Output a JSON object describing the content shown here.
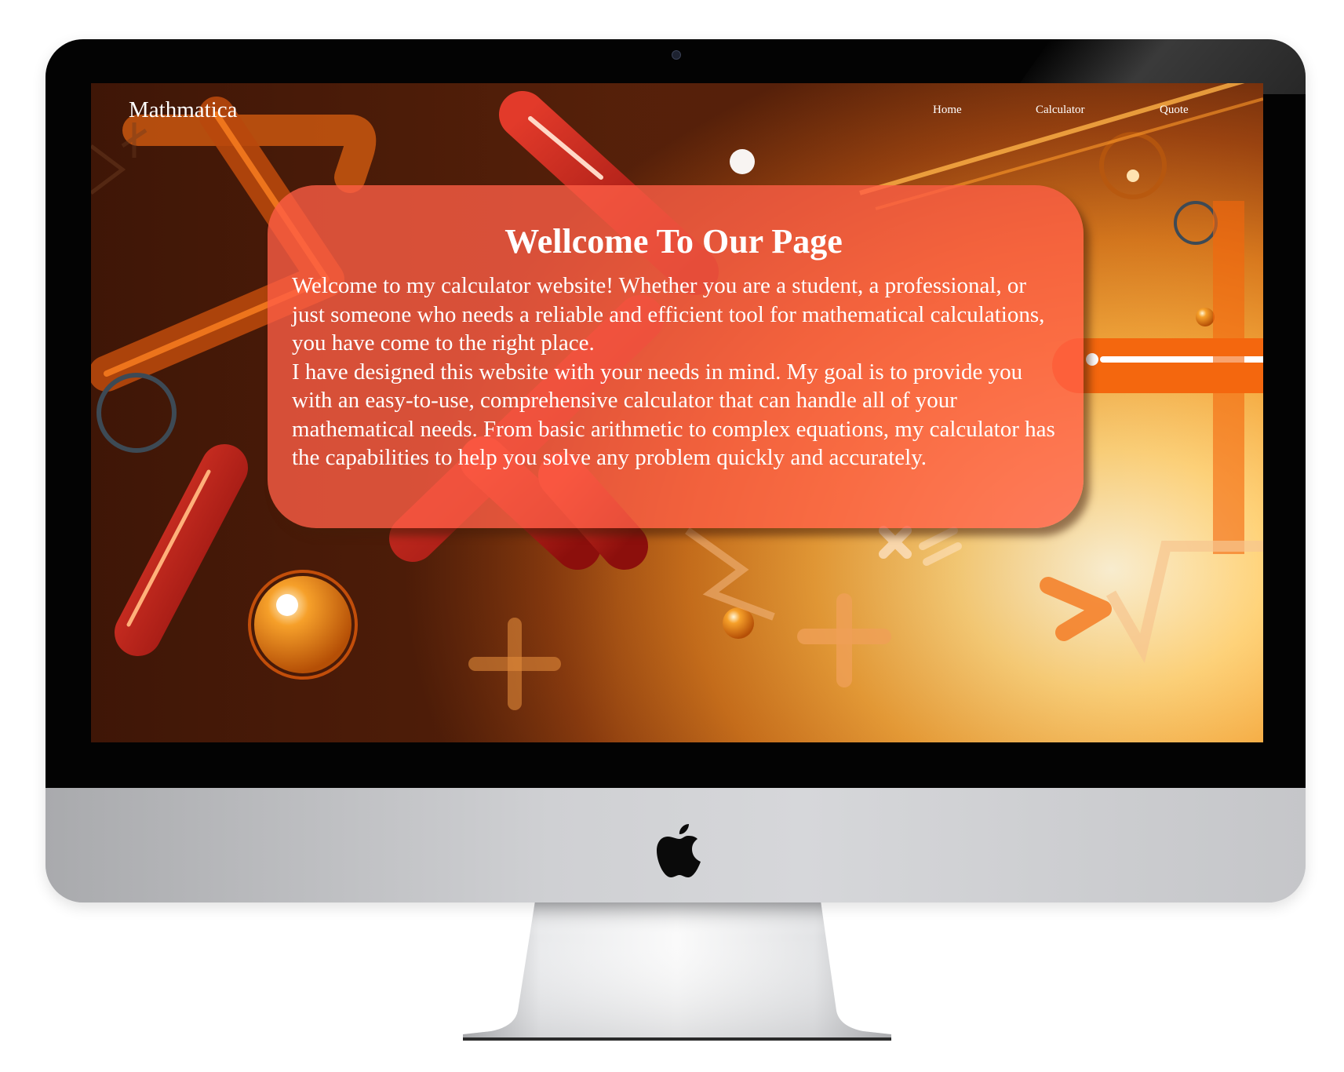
{
  "site": {
    "brand": "Mathmatica"
  },
  "nav": {
    "items": [
      {
        "label": "Home"
      },
      {
        "label": "Calculator"
      },
      {
        "label": "Quote"
      }
    ]
  },
  "hero": {
    "title": "Wellcome To Our Page",
    "paragraphs": [
      "Welcome to my calculator website! Whether you are a student, a professional, or just someone who needs a reliable and efficient tool for mathematical calculations, you have come to the right place.",
      "I have designed this website with your needs in mind. My goal is to provide you with an easy-to-use, comprehensive calculator that can handle all of your mathematical needs. From basic arithmetic to complex equations, my calculator has the capabilities to help you solve any problem quickly and accurately."
    ]
  },
  "colors": {
    "card": "#ff5f46",
    "bezel": "#030303",
    "chin": "#cfd0d3"
  },
  "icons": {
    "device_logo": "apple-logo-icon",
    "camera": "camera-icon"
  }
}
